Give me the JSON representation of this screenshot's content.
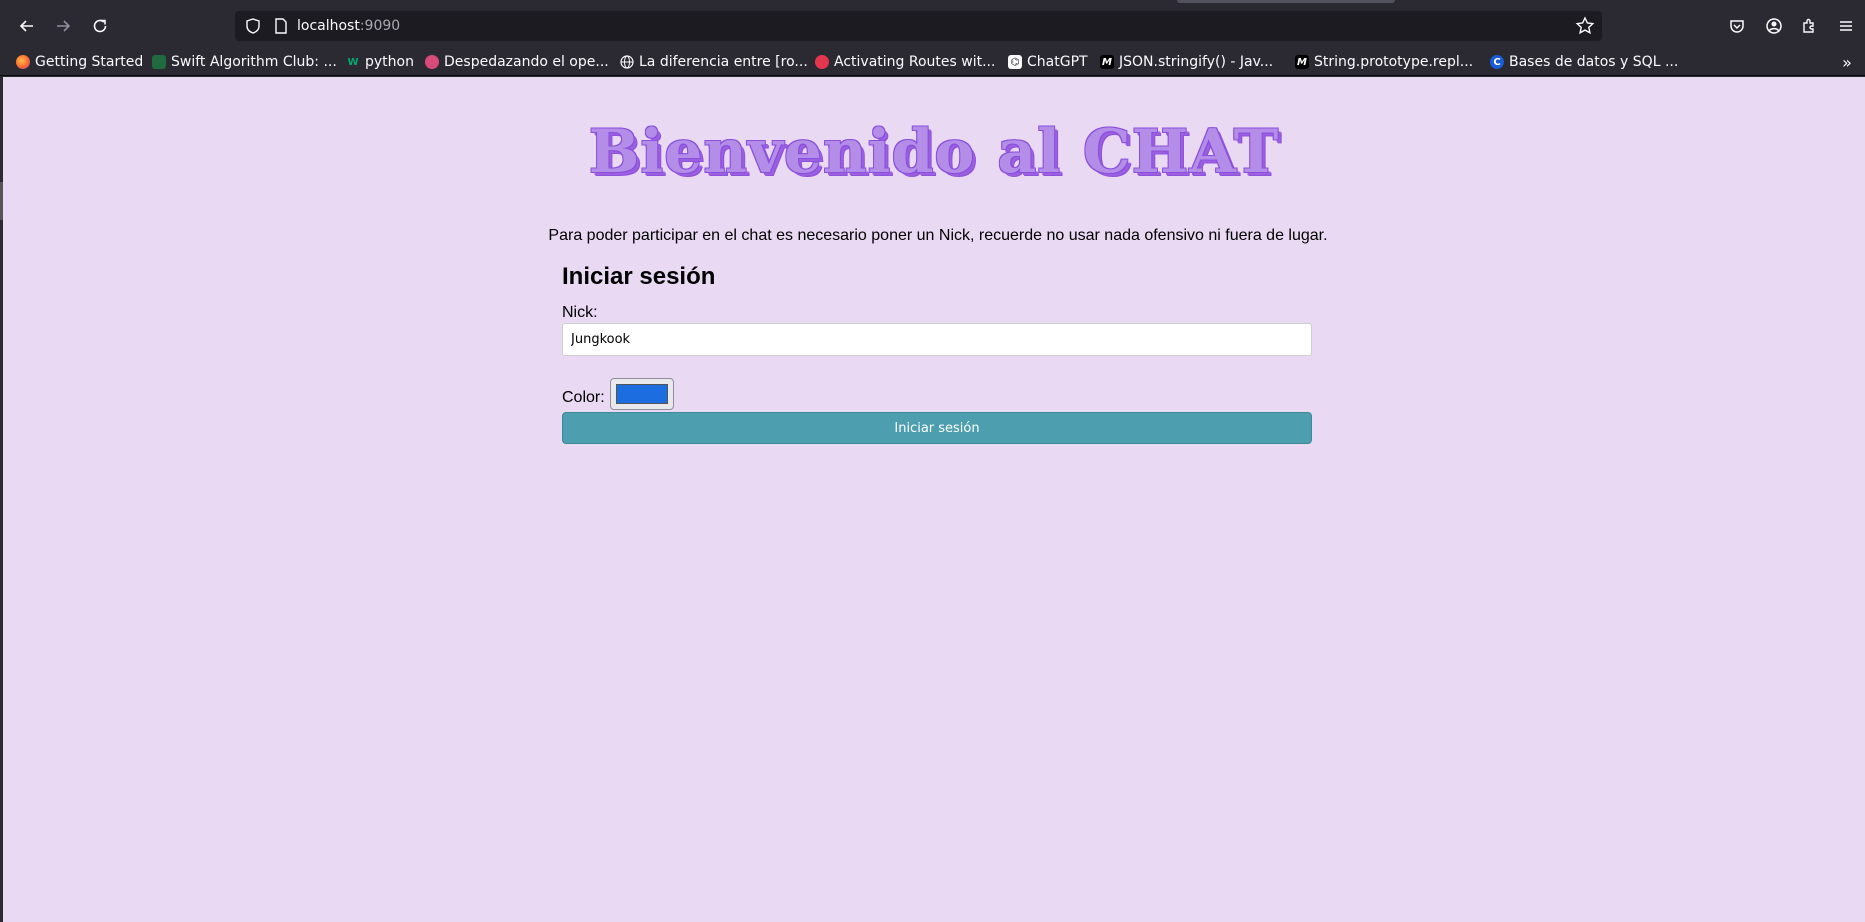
{
  "browser": {
    "url_host": "localhost",
    "url_port": ":9090",
    "icons": [
      "back-icon",
      "forward-icon",
      "reload-icon",
      "shield-icon",
      "page-icon",
      "bookmark-star-icon",
      "pocket-icon",
      "account-icon",
      "extensions-icon",
      "menu-icon"
    ],
    "bookmarks": [
      {
        "label": "Getting Started",
        "icon": "firefox-icon"
      },
      {
        "label": "Swift Algorithm Club: ...",
        "icon": "github-icon"
      },
      {
        "label": "python",
        "icon": "w3-icon"
      },
      {
        "label": "Despedazando el ope...",
        "icon": "site-icon"
      },
      {
        "label": "La diferencia entre [ro...",
        "icon": "globe-icon"
      },
      {
        "label": "Activating Routes wit...",
        "icon": "site-icon"
      },
      {
        "label": "ChatGPT",
        "icon": "chatgpt-icon"
      },
      {
        "label": "JSON.stringify() - Jav...",
        "icon": "mdn-icon"
      },
      {
        "label": "String.prototype.repl...",
        "icon": "mdn-icon"
      },
      {
        "label": "Bases de datos y SQL ...",
        "icon": "c-icon"
      }
    ],
    "overflow_label": "»"
  },
  "page": {
    "title": "Bienvenido al CHAT",
    "intro": "Para poder participar en el chat es necesario poner un Nick, recuerde no usar nada ofensivo ni fuera de lugar.",
    "form": {
      "heading": "Iniciar sesión",
      "nick_label": "Nick:",
      "nick_value": "Jungkook",
      "color_label": "Color:",
      "color_value": "#1c6ee0",
      "submit_label": "Iniciar sesión"
    }
  },
  "colors": {
    "page_bg": "#e9d9f3",
    "title_fill": "#b48de8",
    "title_outline": "#8a4fdc",
    "button_bg": "#4d9fb0"
  }
}
